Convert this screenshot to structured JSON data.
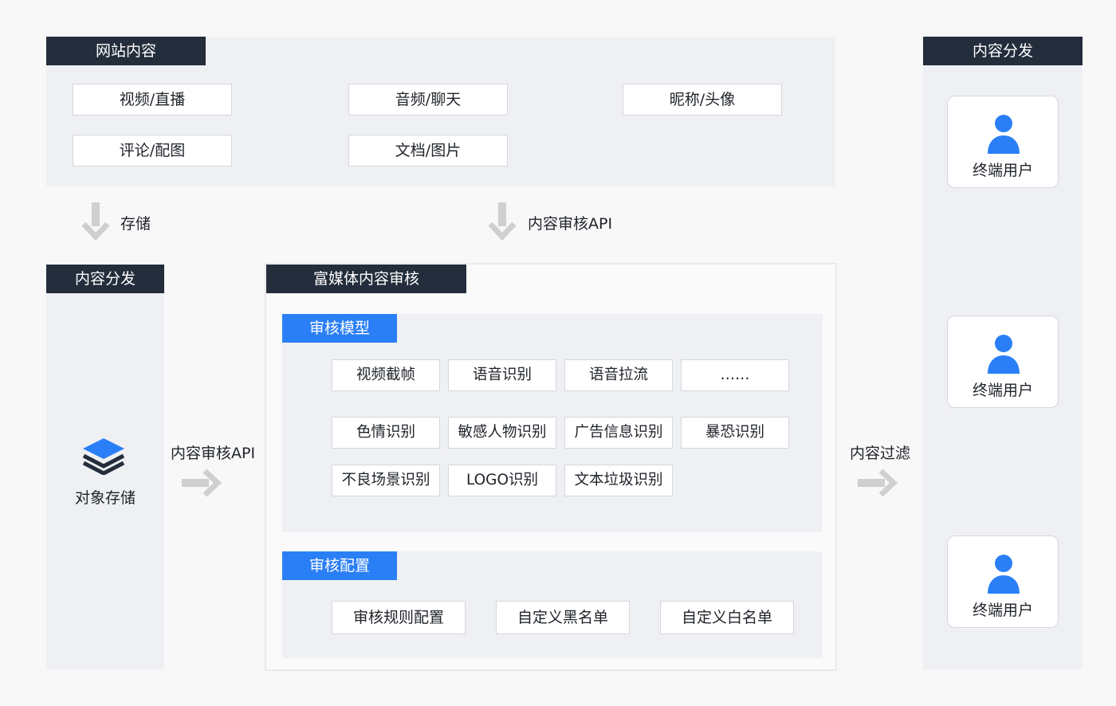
{
  "website": {
    "title": "网站内容",
    "items": [
      "视频/直播",
      "音频/聊天",
      "昵称/头像",
      "评论/配图",
      "文档/图片"
    ]
  },
  "arrows": {
    "storage_label": "存储",
    "api_label_top": "内容审核API",
    "api_label_mid": "内容审核API",
    "filter_label": "内容过滤"
  },
  "left_panel": {
    "title": "内容分发",
    "storage_label": "对象存储",
    "storage_icon": "layers-icon"
  },
  "review": {
    "title": "富媒体内容审核",
    "model": {
      "title": "审核模型",
      "items": [
        "视频截帧",
        "语音识别",
        "语音拉流",
        "……",
        "色情识别",
        "敏感人物识别",
        "广告信息识别",
        "暴恐识别",
        "不良场景识别",
        "LOGO识别",
        "文本垃圾识别"
      ]
    },
    "config": {
      "title": "审核配置",
      "items": [
        "审核规则配置",
        "自定义黑名单",
        "自定义白名单"
      ]
    }
  },
  "right_panel": {
    "title": "内容分发",
    "users": [
      "终端用户",
      "终端用户",
      "终端用户"
    ],
    "user_icon": "user-icon"
  },
  "colors": {
    "header_dark": "#232d3b",
    "accent_blue": "#2b7ff6",
    "panel_gray": "#eff0f4",
    "arrow_gray": "#cfcfd1"
  }
}
